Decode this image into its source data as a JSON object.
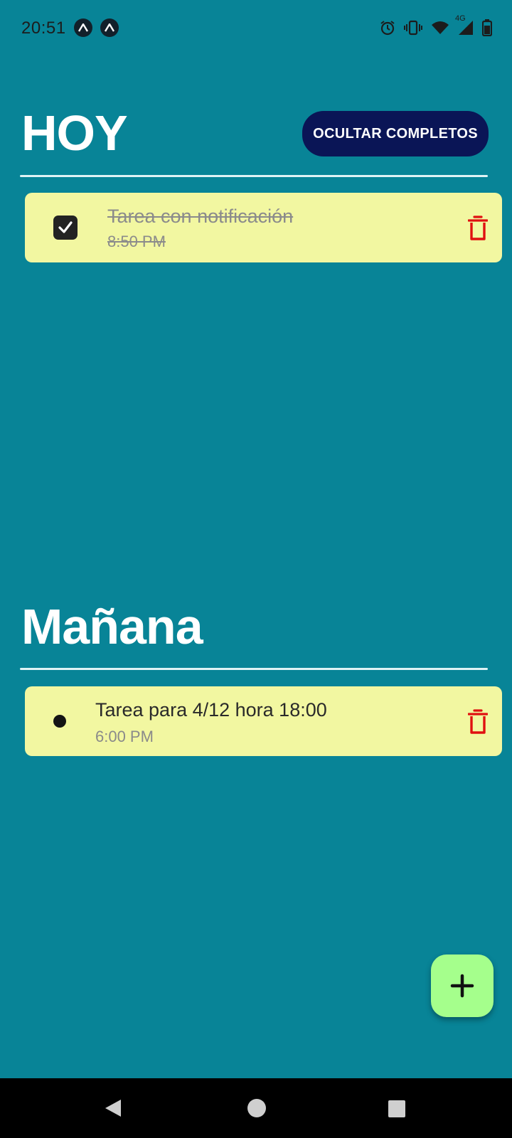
{
  "status_bar": {
    "time": "20:51",
    "network": "4G",
    "icons": [
      "notification-app-icon",
      "notification-app-icon",
      "alarm-icon",
      "vibrate-icon",
      "wifi-icon",
      "signal-icon",
      "battery-icon"
    ]
  },
  "today": {
    "title": "HOY",
    "hide_completed_label": "OCULTAR COMPLETOS",
    "tasks": [
      {
        "title": "Tarea con notificación",
        "time": "8:50 PM",
        "completed": true
      }
    ]
  },
  "tomorrow": {
    "title": "Mañana",
    "tasks": [
      {
        "title": "Tarea para 4/12 hora 18:00",
        "time": "6:00 PM",
        "completed": false
      }
    ]
  },
  "fab": {
    "icon": "plus-icon"
  },
  "colors": {
    "background": "#088497",
    "card": "#f2f7a1",
    "button": "#0a1556",
    "fab": "#a5ff8c",
    "delete": "#e01010"
  },
  "nav_bar": {
    "icons": [
      "back-icon",
      "home-icon",
      "recents-icon"
    ]
  }
}
